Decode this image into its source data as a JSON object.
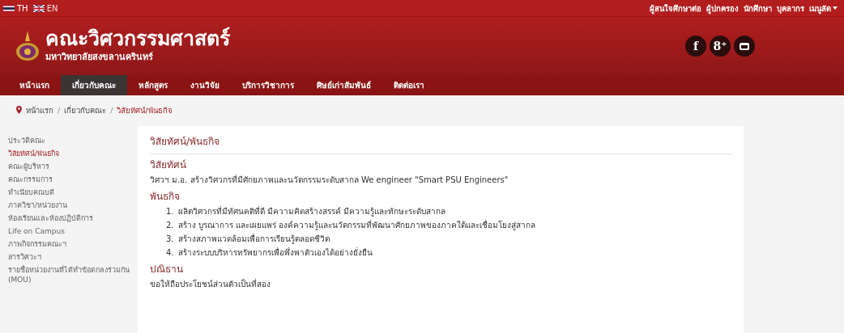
{
  "languages": [
    {
      "code": "TH",
      "kind": "thai",
      "selected": true
    },
    {
      "code": "EN",
      "kind": "british",
      "selected": false
    }
  ],
  "top_links": [
    {
      "label": "ผู้สนใจศึกษาต่อ",
      "dropdown": false
    },
    {
      "label": "ผู้ปกครอง",
      "dropdown": false
    },
    {
      "label": "นักศึกษา",
      "dropdown": false
    },
    {
      "label": "บุคลากร",
      "dropdown": false
    },
    {
      "label": "เมนูลัด",
      "dropdown": true
    }
  ],
  "header": {
    "title": "คณะวิศวกรรมศาสตร์",
    "subtitle": "มหาวิทยาลัยสงขลานครินทร์"
  },
  "social": [
    {
      "kind": "text",
      "label": "f"
    },
    {
      "kind": "text",
      "label": "8⁺"
    },
    {
      "kind": "video"
    }
  ],
  "nav": [
    {
      "label": "หน้าแรก",
      "selected": false
    },
    {
      "label": "เกี่ยวกับคณะ",
      "selected": true
    },
    {
      "label": "หลักสูตร",
      "selected": false
    },
    {
      "label": "งานวิจัย",
      "selected": false
    },
    {
      "label": "บริการวิชาการ",
      "selected": false
    },
    {
      "label": "ศิษย์เก่าสัมพันธ์",
      "selected": false
    },
    {
      "label": "ติดต่อเรา",
      "selected": false
    }
  ],
  "breadcrumb": [
    {
      "label": "หน้าแรก",
      "current": false,
      "separator": "/"
    },
    {
      "label": "เกี่ยวกับคณะ",
      "current": false,
      "separator": "/"
    },
    {
      "label": "วิสัยทัศน์/พันธกิจ",
      "current": true
    }
  ],
  "sidebar": {
    "items": [
      {
        "label": "ประวัติคณะ",
        "selected": false
      },
      {
        "label": "วิสัยทัศน์/พันธกิจ",
        "selected": true
      },
      {
        "label": "คณะผู้บริหาร",
        "selected": false
      },
      {
        "label": "คณะกรรมการ",
        "selected": false
      },
      {
        "label": "ทำเนียบคณบดี",
        "selected": false
      },
      {
        "label": "ภาควิชา/หน่วยงาน",
        "selected": false
      },
      {
        "label": "ห้องเรียนและห้องปฏิบัติการ",
        "selected": false
      },
      {
        "label": "Life on Campus",
        "selected": false
      },
      {
        "label": "ภาพกิจกรรมคณะฯ",
        "selected": false
      },
      {
        "label": "สารวิศวะฯ",
        "selected": false
      },
      {
        "label": "รายชื่อหน่วยงานที่ได้ทำข้อตกลงร่วมกัน (MOU)",
        "selected": false
      }
    ]
  },
  "article": {
    "title": "วิสัยทัศน์/พันธกิจ",
    "sections": [
      {
        "kind": "paragraph",
        "heading": "วิสัยทัศน์",
        "text": "วิศวฯ ม.อ. สร้างวิศวกรที่มีศักยภาพและนวัตกรรมระดับสากล We engineer \"Smart PSU Engineers\""
      },
      {
        "kind": "list",
        "heading": "พันธกิจ",
        "items": [
          {
            "number": "1.",
            "text": "ผลิตวิศวกรที่มีทัศนคติที่ดี มีความคิดสร้างสรรค์ มีความรู้และทักษะระดับสากล"
          },
          {
            "number": "2.",
            "text": "สร้าง บูรณาการ และเผยแพร่ องค์ความรู้และนวัตกรรมที่พัฒนาศักยภาพของภาคใต้และเชื่อมโยงสู่สากล"
          },
          {
            "number": "3.",
            "text": "สร้างสภาพแวดล้อมเพื่อการเรียนรู้ตลอดชีวิต"
          },
          {
            "number": "4.",
            "text": "สร้างระบบบริหารทรัพยากรเพื่อพึ่งพาตัวเองได้อย่างยั่งยืน"
          }
        ]
      },
      {
        "kind": "paragraph",
        "heading": "ปณิธาน",
        "text": "ขอให้ถือประโยชน์ส่วนตัวเป็นที่สอง"
      }
    ]
  }
}
